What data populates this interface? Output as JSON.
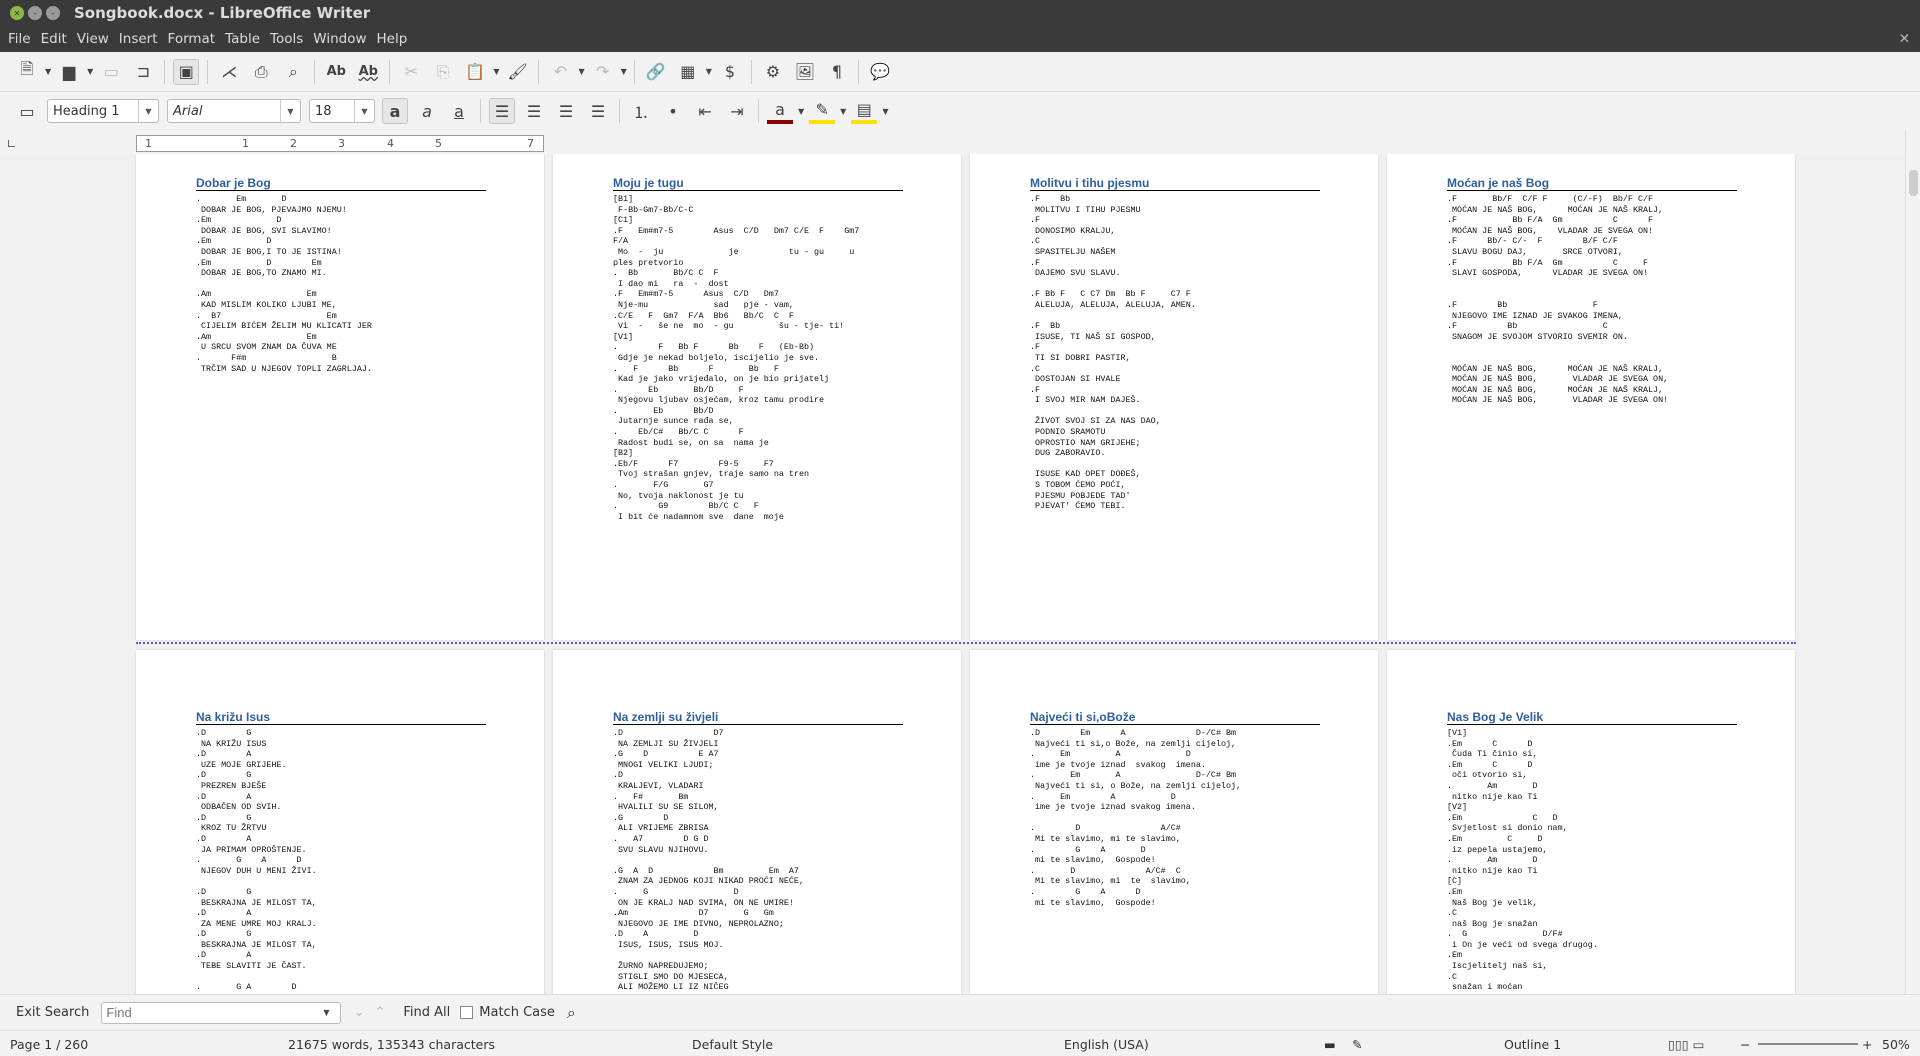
{
  "window": {
    "title": "Songbook.docx - LibreOffice Writer"
  },
  "menu": [
    "File",
    "Edit",
    "View",
    "Insert",
    "Format",
    "Table",
    "Tools",
    "Window",
    "Help"
  ],
  "formatting": {
    "paragraph_style": "Heading 1",
    "font_name": "Arial",
    "font_size": "18"
  },
  "ruler": {
    "ticks": [
      "1",
      "1",
      "2",
      "3",
      "4",
      "5",
      "7"
    ]
  },
  "pages": [
    {
      "title": "Dobar je Bog",
      "body": ".       Em       D\n DOBAR JE BOG, PJEVAJMO NJEMU!\n.Em             D\n DOBAR JE BOG, SVI SLAVIMO!\n.Em           D\n DOBAR JE BOG,I TO JE ISTINA!\n.Em           D        Em\n DOBAR JE BOG,TO ZNAMO MI.\n\n.Am                   Em\n KAD MISLIM KOLIKO LJUBI ME,\n.  B7                     Em\n CIJELIM BIĆEM ŽELIM MU KLICATI JER\n.Am                   Em\n U SRCU SVOM ZNAM DA ČUVA ME\n.      F#m                 B\n TRČIM SAD U NJEGOV TOPLI ZAGRLJAJ."
    },
    {
      "title": "Moju je tugu",
      "body": "[B1]\n F-Bb-Gm7-Bb/C-C\n[C1]\n.F   Em#m7-5        Asus  C/D   Dm7 C/E  F    Gm7\nF/A\n Mo  -  ju             je          tu - gu     u\nples pretvorio\n.  Bb       Bb/C C  F\n I dao mi   ra  -  dost\n.F   Em#m7-5      Asus  C/D   Dm7\n Nje-mu             sad   pje - vam,\n.C/E   F  Gm7  F/A  Bb6   Bb/C  C  F\n Vi  -   še ne  mo  - gu         šu - tje- ti!\n[V1]\n.        F   Bb F      Bb    F   (Eb-Bb)\n Gdje je nekad boljelo, iscijelio je sve.\n.   F      Bb      F       Bb   F\n Kad je jako vrijeđalo, on je bio prijatelj\n.      Eb       Bb/D     F\n Njegovu ljubav osjećam, kroz tamu prodire\n.       Eb      Bb/D\n Jutarnje sunce rađa se,\n.    Eb/C#   Bb/C C      F\n Radost budi se, on sa  nama je\n[B2]\n.Eb/F      F7        F9-5     F7\n Tvoj strašan gnjev, traje samo na tren\n.       F/G       G7\n No, tvoja naklonost je tu\n.        G9        Bb/C C   F\n I bit će nadamnom sve  dane  moje"
    },
    {
      "title": "Molitvu i tihu pjesmu",
      "body": ".F    Bb\n MOLITVU I TIHU PJESMU\n.F\n DONOSIMO KRALJU,\n.C\n SPASITELJU NAŠEM\n.F\n DAJEMO SVU SLAVU.\n\n.F Bb F   C C7 Dm  Bb F     C7 F\n ALELUJA, ALELUJA, ALELUJA, AMEN.\n\n.F  Bb\n ISUSE, TI NAŠ SI GOSPOD,\n.F\n TI SI DOBRI PASTIR,\n.C\n DOSTOJAN SI HVALE\n.F\n I SVOJ MIR NAM DAJEŠ.\n\n ŽIVOT SVOJ SI ZA NAS DAO,\n PODNIO SRAMOTU\n OPROSTIO NAM GRIJEHE;\n DUG ZABORAVIO.\n\n ISUSE KAD OPET DOĐEŠ,\n S TOBOM ĆEMO POĆI,\n PJESMU POBJEDE TAD'\n PJEVAT' ĆEMO TEBI."
    },
    {
      "title": "Moćan je naš Bog",
      "body": ".F       Bb/F  C/F F     (C/-F)  Bb/F C/F\n MOĆAN JE NAŠ BOG,      MOĆAN JE NAŠ KRALJ,\n.F           Bb F/A  Gm          C      F\n MOĆAN JE NAŠ BOG,    VLADAR JE SVEGA ON!\n.F      Bb/- C/-  F        B/F C/F\n SLAVU BOGU DAJ,       SRCE OTVORI,\n.F           Bb F/A  Gm          C     F\n SLAVI GOSPODA,      VLADAR JE SVEGA ON!\n\n\n.F        Bb                 F\n NJEGOVO IME IZNAD JE SVAKOG IMENA,\n.F          Bb                 C\n SNAGOM JE SVOJOM STVORIO SVEMIR ON.\n\n\n MOĆAN JE NAŠ BOG,      MOĆAN JE NAŠ KRALJ,\n MOĆAN JE NAŠ BOG,       VLADAR JE SVEGA ON,\n MOĆAN JE NAŠ BOG,      MOĆAN JE NAŠ KRALJ,\n MOĆAN JE NAŠ BOG,       VLADAR JE SVEGA ON!"
    },
    {
      "title": "Na križu Isus",
      "body": ".D        G\n NA KRIŽU ISUS\n.D        A\n UZE MOJE GRIJEHE.\n.D        G\n PREZREN BJEŠE\n.D        A\n ODBAČEN OD SVIH.\n.D        G\n KROZ TU ŽRTVU\n.D        A\n JA PRIMAM OPROŠTENJE.\n.       G    A      D\n NJEGOV DUH U MENI ŽIVI.\n\n.D        G\n BESKRAJNA JE MILOST TA,\n.D        A\n ZA MENE UMRE MOJ KRALJ.\n.D        G\n BESKRAJNA JE MILOST TA,\n.D        A\n TEBE SLAVITI JE ČAST.\n\n.       G A        D"
    },
    {
      "title": "Na zemlji su živjeli",
      "body": ".D                  D7\n NA ZEMLJI SU ŽIVJELI\n.G    D          E A7\n MNOGI VELIKI LJUDI;\n.D\n KRALJEVI, VLADARI\n.   F#       Bm\n HVALILI SU SE SILOM,\n.G        D\n ALI VRIJEME ZBRISA\n.   A7        D G D\n SVU SLAVU NJIHOVU.\n\n.G  A  D            Bm         Em  A7\n ZNAM ZA JEDNOG KOJI NIKAD PROĆI NEĆE,\n.     G                 D\n ON JE KRALJ NAD SVIMA, ON NE UMIRE!\n.Am              D7       G   Gm\n NJEGOVO JE IME DIVNO, NEPROLAZNO;\n.D    A         D\n ISUS, ISUS, ISUS MOJ.\n\n ŽURNO NAPREDUJEMO;\n STIGLI SMO DO MJESECA,\n ALI MOŽEMO LI IZ NIČEG"
    },
    {
      "title": "Najveći ti si,oBože",
      "body": ".D        Em      A              D-/C# Bm\n Najveći ti si,o Bože, na zemlji cijeloj,\n.     Em         A             D\n ime je tvoje iznad  svakog  imena.\n.       Em       A               D-/C# Bm\n Najveći ti si, o Bože, na zemlji cijeloj,\n.     Em        A           D\n ime je tvoje iznad svakog imena.\n\n.        D                A/C#\n Mi te slavimo, mi te slavimo,\n.        G    A       D\n mi te slavimo,  Gospode!\n.       D              A/C#  C\n Mi te slavimo, mi  te  slavimo,\n.        G    A      D\n mi te slavimo,  Gospode!"
    },
    {
      "title": "Nas Bog Je Velik",
      "body": "[V1]\n.Em      C      D\n Čuda Ti činio si,\n.Em      C      D\n oči otvorio si,\n.       Am       D\n nitko nije kao Ti\n[V2]\n.Em              C   D\n Svjetlost si donio nam,\n.Em         C     D\n iz pepela ustajemo,\n.       Am       D\n nitko nije kao Ti\n[C]\n.Em\n Naš Bog je velik,\n.C\n naš Bog je snažan\n.  G               D/F#\n i On je veći od svega drugog.\n.Em\n Iscjelitelj naš si,\n.C\n snažan i moćan"
    }
  ],
  "find": {
    "exit_label": "Exit Search",
    "placeholder": "Find",
    "find_all_label": "Find All",
    "match_case_label": "Match Case"
  },
  "status": {
    "page": "Page 1 / 260",
    "words": "21675 words, 135343 characters",
    "style": "Default Style",
    "language": "English (USA)",
    "outline": "Outline 1",
    "zoom": "50%"
  }
}
